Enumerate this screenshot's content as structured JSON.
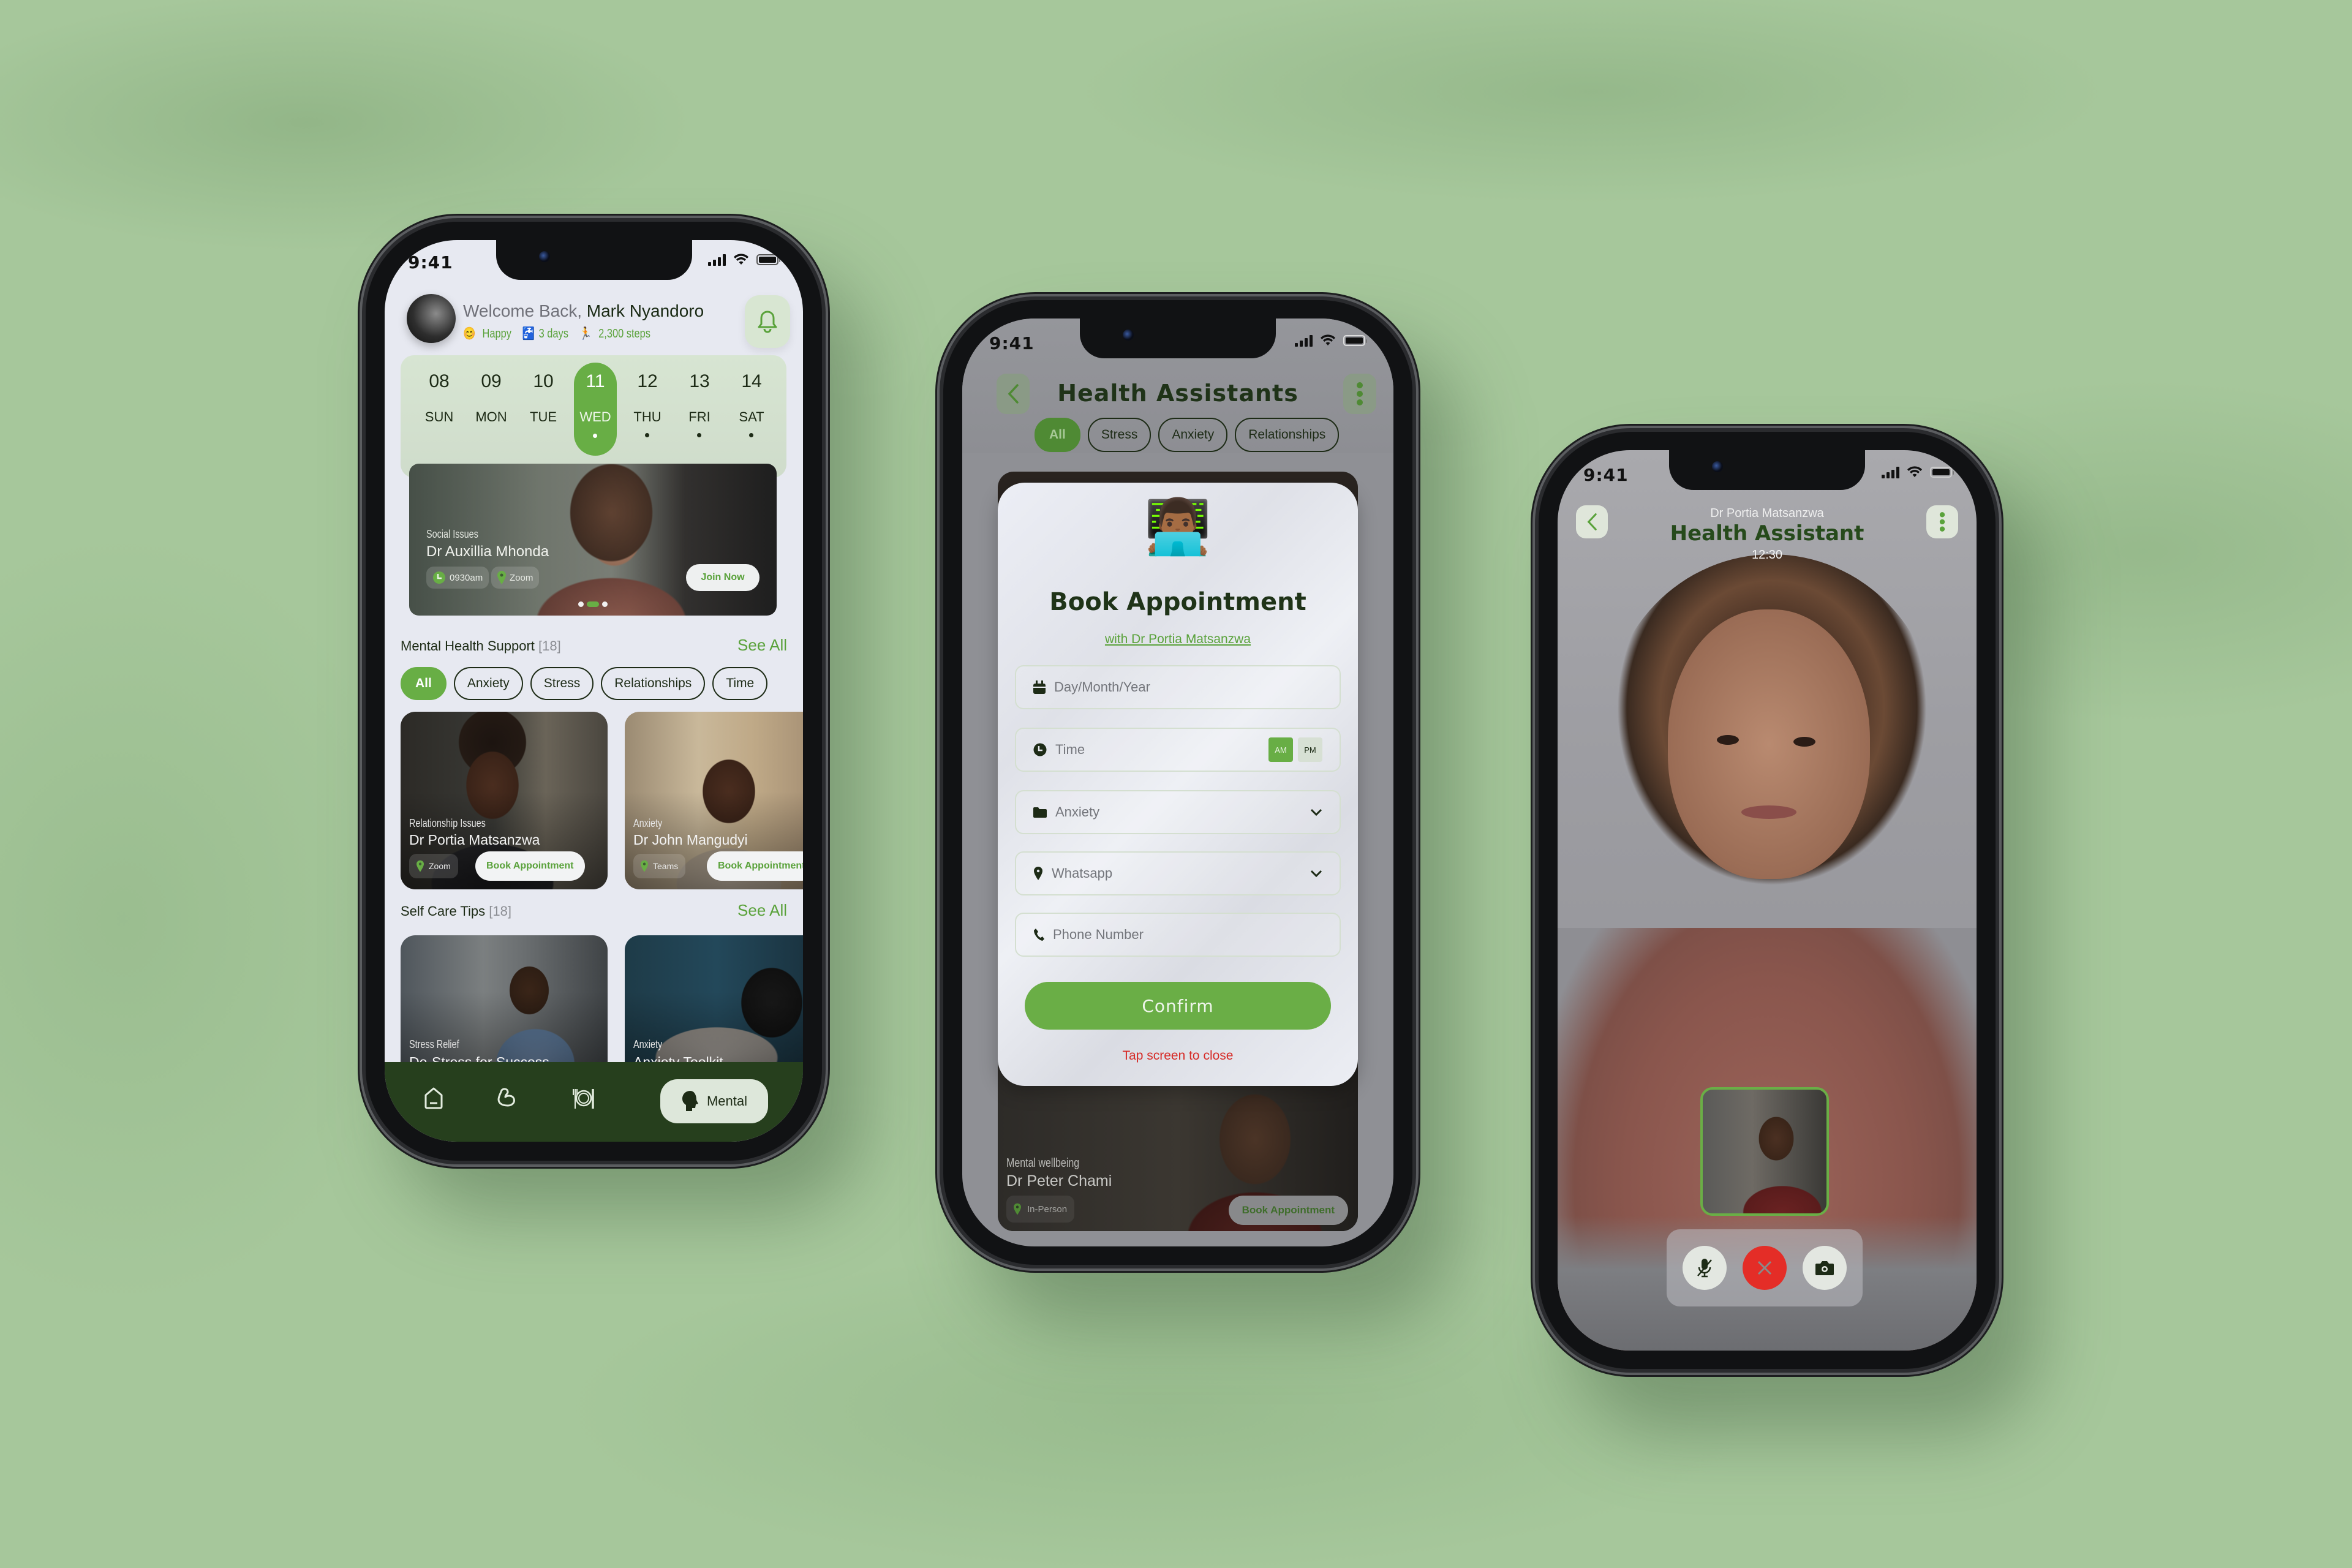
{
  "status_bar": {
    "time": "9:41"
  },
  "home_screen": {
    "greeting": "Welcome Back,",
    "user_name": "Mark Nyandoro",
    "stats": [
      {
        "icon": "smiling-face-icon",
        "glyph": "😊",
        "label": "Happy"
      },
      {
        "icon": "water-tap-icon",
        "glyph": "🚰",
        "label": "3 days"
      },
      {
        "icon": "runner-icon",
        "glyph": "🏃",
        "label": "2,300 steps"
      }
    ],
    "calendar": [
      {
        "num": "08",
        "day": "SUN",
        "dot": false
      },
      {
        "num": "09",
        "day": "MON",
        "dot": false
      },
      {
        "num": "10",
        "day": "TUE",
        "dot": false
      },
      {
        "num": "11",
        "day": "WED",
        "dot": true,
        "active": true
      },
      {
        "num": "12",
        "day": "THU",
        "dot": true
      },
      {
        "num": "13",
        "day": "FRI",
        "dot": true
      },
      {
        "num": "14",
        "day": "SAT",
        "dot": true
      }
    ],
    "featured_session": {
      "category": "Social Issues",
      "doctor": "Dr Auxillia Mhonda",
      "time": "0930am",
      "platform": "Zoom",
      "join_label": "Join Now",
      "carousel": {
        "count": 3,
        "active_index": 1
      }
    },
    "mental_support": {
      "title": "Mental Health Support",
      "count": "[18]",
      "see_all": "See All",
      "filters": [
        "All",
        "Anxiety",
        "Stress",
        "Relationships",
        "Time"
      ],
      "active_filter": "All",
      "cards": [
        {
          "category": "Relationship Issues",
          "doctor": "Dr Portia Matsanzwa",
          "platform": "Zoom",
          "book_label": "Book Appointment"
        },
        {
          "category": "Anxiety",
          "doctor": "Dr John Mangudyi",
          "platform": "Teams",
          "book_label": "Book Appointment"
        }
      ]
    },
    "self_care": {
      "title": "Self Care Tips",
      "count": "[18]",
      "see_all": "See All",
      "cards": [
        {
          "category": "Stress Relief",
          "title": "De-Stress for Success"
        },
        {
          "category": "Anxiety",
          "title": "Anxiety Toolkit"
        }
      ]
    },
    "nav": {
      "items": [
        "home",
        "fitness",
        "nutrition",
        "mental"
      ],
      "active_label": "Mental"
    }
  },
  "booking_screen": {
    "title": "Health Assistants",
    "filters": [
      "All",
      "Stress",
      "Anxiety",
      "Relationships"
    ],
    "active_filter": "All",
    "modal": {
      "emoji": "👨🏾‍💻",
      "title": "Book Appointment",
      "with": "with Dr Portia Matsanzwa",
      "date_placeholder": "Day/Month/Year",
      "time_placeholder": "Time",
      "am": "AM",
      "pm": "PM",
      "am_selected": true,
      "category_value": "Anxiety",
      "platform_value": "Whatsapp",
      "phone_placeholder": "Phone Number",
      "confirm_label": "Confirm",
      "close_hint": "Tap screen to close"
    },
    "background_card": {
      "category": "Mental wellbeing",
      "doctor": "Dr Peter Chami",
      "platform": "In-Person",
      "book_label": "Book Appointment"
    }
  },
  "call_screen": {
    "doctor": "Dr Portia Matsanzwa",
    "title": "Health Assistant",
    "duration": "12:30",
    "controls": [
      "mute-microphone",
      "end-call",
      "camera"
    ],
    "colors": {
      "accent": "#68ae45",
      "end_call": "#e42d27"
    }
  },
  "theme": {
    "accent_green": "#68ae45",
    "dark_green": "#263f1d",
    "text_dark": "#1d2b16",
    "alert_red": "#d62a26"
  }
}
